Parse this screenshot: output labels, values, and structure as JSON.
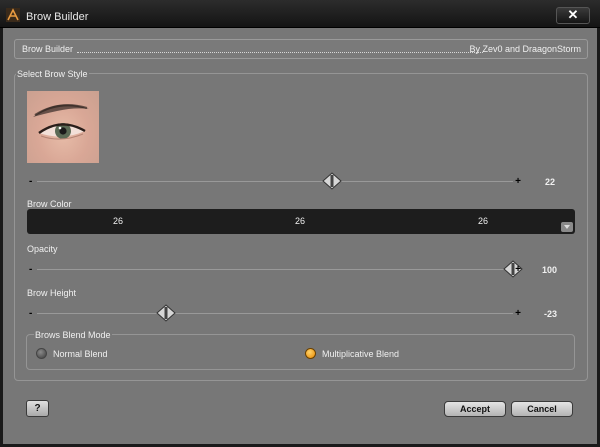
{
  "window": {
    "title": "Brow Builder",
    "close_label": "✕"
  },
  "header": {
    "left_text": "Brow Builder",
    "right_text": "By Zev0 and DraagonStorm"
  },
  "group": {
    "label": "Select Brow Style"
  },
  "sliders": {
    "style": {
      "value_text": "22",
      "fraction": 0.62
    },
    "opacity": {
      "label": "Opacity",
      "value_text": "100",
      "fraction": 1.0
    },
    "height": {
      "label": "Brow Height",
      "value_text": "-23",
      "fraction": 0.27
    }
  },
  "brow_color": {
    "label": "Brow Color",
    "r": "26",
    "g": "26",
    "b": "26"
  },
  "blend": {
    "label": "Brows Blend Mode",
    "normal_label": "Normal Blend",
    "multiplicative_label": "Multiplicative Blend",
    "selected": "multiplicative"
  },
  "footer": {
    "help_label": "?",
    "accept_label": "Accept",
    "cancel_label": "Cancel"
  },
  "colors": {
    "accent_orange": "#f0a020",
    "panel": "#777777",
    "color_bar": "#1d1d1d"
  }
}
